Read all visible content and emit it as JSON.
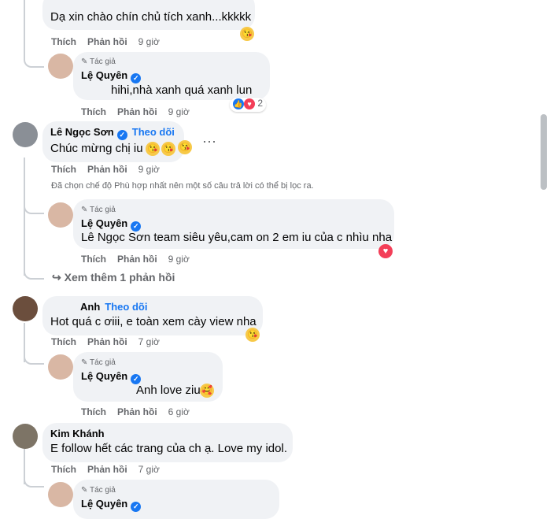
{
  "labels": {
    "like": "Thích",
    "reply": "Phản hồi",
    "author_tag": "Tác giả",
    "follow": "Theo dõi"
  },
  "comments": [
    {
      "text": "Dạ xin chào chín chủ tích xanh...kkkkk",
      "time": "9 giờ"
    },
    {
      "name": "Lệ Quyên",
      "text": "hihi,nhà xanh quá xanh lun",
      "time": "9 giờ",
      "reaction_count": "2"
    },
    {
      "name": "Lê Ngọc Sơn",
      "text": "Chúc mừng chị iu",
      "time": "9 giờ",
      "filter_note": "Đã chọn chế độ Phù hợp nhất nên một số câu trả lời có thể bị lọc ra."
    },
    {
      "name": "Lệ Quyên",
      "text": "Lê Ngọc Sơn team siêu yêu,cam on 2 em iu của c nhìu nha",
      "time": "9 giờ"
    },
    {
      "see_more": "Xem thêm 1 phản hồi"
    },
    {
      "name": "Anh",
      "text": "Hot quá c ơiii, e toàn xem cày view nha",
      "time": "7 giờ"
    },
    {
      "name": "Lệ Quyên",
      "text": "Anh love ziu",
      "time": "6 giờ"
    },
    {
      "name": "Kim Khánh",
      "text": "E follow hết các trang của ch ạ. Love my idol.",
      "time": "7 giờ"
    },
    {
      "name": "Lệ Quyên"
    }
  ],
  "colors": {
    "bubble": "#f0f2f5",
    "link": "#1877f2",
    "meta": "#65676b",
    "emoji": "#f7c948"
  },
  "icons": [
    "pencil-icon",
    "verified-badge-icon",
    "reply-arrow-icon",
    "emoji-reaction-icon",
    "like-reaction-icon",
    "heart-reaction-icon"
  ]
}
